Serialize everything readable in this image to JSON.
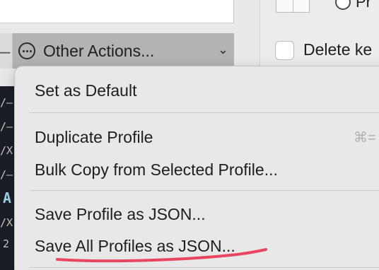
{
  "actions_button": {
    "label": "Other Actions...",
    "icon": "ellipsis-circle-icon"
  },
  "left_bar": {
    "minus_label": "–"
  },
  "terminal_lines": [
    "/–",
    "/–",
    "/X",
    "/–",
    "A",
    "/X",
    "2"
  ],
  "right_pane": {
    "radio_label": "Pr",
    "checkbox_label": "Delete ke"
  },
  "menu": {
    "groups": [
      {
        "items": [
          {
            "label": "Set as Default"
          }
        ]
      },
      {
        "items": [
          {
            "label": "Duplicate Profile",
            "shortcut": "⌘="
          },
          {
            "label": "Bulk Copy from Selected Profile..."
          }
        ]
      },
      {
        "items": [
          {
            "label": "Save Profile as JSON..."
          },
          {
            "label": "Save All Profiles as JSON..."
          }
        ]
      }
    ]
  },
  "annotation": {
    "color": "#e8465f"
  }
}
